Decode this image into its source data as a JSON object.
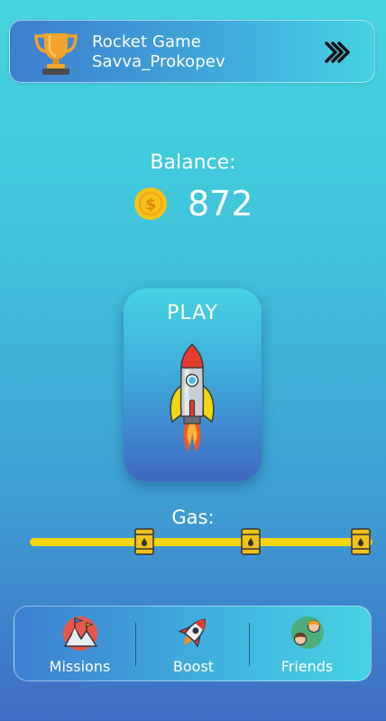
{
  "header": {
    "app_title": "Rocket Game",
    "username": "Savva_Prokopev",
    "trophy_icon": "trophy-icon",
    "forward_icon": "double-chevron-right-icon"
  },
  "balance": {
    "label": "Balance:",
    "value": "872",
    "coin_icon": "coin-icon"
  },
  "play": {
    "label": "PLAY",
    "icon": "rocket-icon"
  },
  "gas": {
    "label": "Gas:",
    "icon": "fuel-barrel-icon"
  },
  "bottom_nav": [
    {
      "label": "Missions",
      "icon": "mountains-icon"
    },
    {
      "label": "Boost",
      "icon": "rocket-icon"
    },
    {
      "label": "Friends",
      "icon": "friends-icon"
    }
  ],
  "colors": {
    "gas_track": "#f2d60f",
    "coin": "#f7c21a",
    "trophy": "#f2a42b",
    "rocket_nose": "#e53a2e"
  }
}
